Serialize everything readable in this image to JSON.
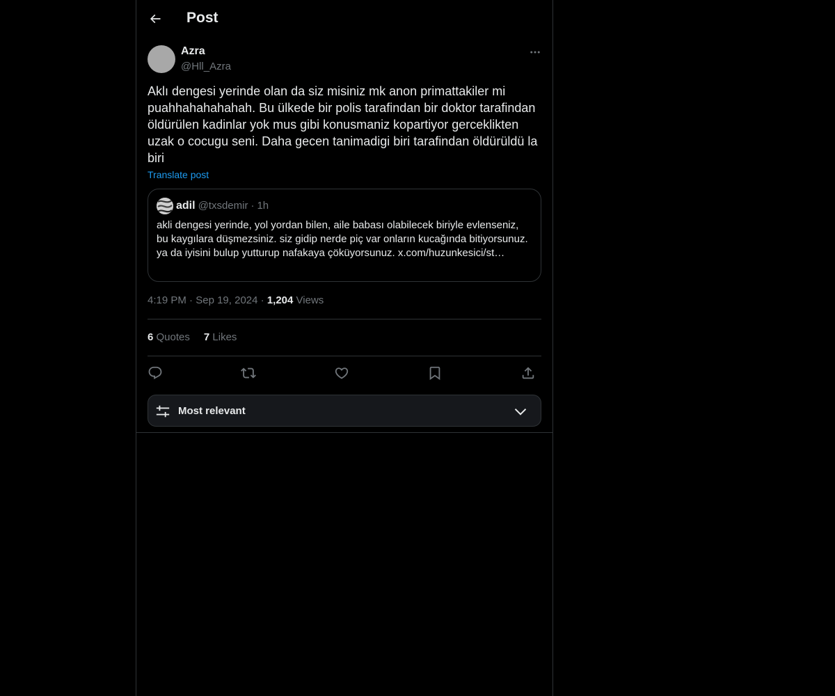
{
  "header": {
    "title": "Post"
  },
  "post": {
    "author": {
      "name": "Azra",
      "handle": "@Hll_Azra"
    },
    "text": "Aklı dengesi yerinde olan da siz misiniz mk anon primattakiler mi puahhahahahahah. Bu ülkede bir polis tarafindan bir doktor tarafindan öldürülen kadinlar yok mus gibi konusmaniz kopartiyor gerceklikten uzak o cocugu seni. Daha gecen tanimadigi biri tarafindan öldürüldü la biri",
    "translate_label": "Translate post",
    "quote": {
      "name": "adil",
      "handle": "@txsdemir",
      "separator": "·",
      "time": "1h",
      "text": "akli dengesi yerinde, yol yordan bilen, aile babası olabilecek biriyle evlenseniz, bu kaygılara düşmezsiniz. siz gidip nerde piç var onların kucağında bitiyorsunuz. ya da iyisini bulup yutturup nafakaya çöküyorsunuz. x.com/huzunkesici/st…"
    },
    "meta": {
      "time": "4:19 PM",
      "separator": "·",
      "date": "Sep 19, 2024",
      "views_count": "1,204",
      "views_label": "Views"
    },
    "stats": {
      "quotes_count": "6",
      "quotes_label": "Quotes",
      "likes_count": "7",
      "likes_label": "Likes"
    },
    "actions": {
      "icons": [
        "reply-icon",
        "repost-icon",
        "like-icon",
        "bookmark-icon",
        "share-icon"
      ]
    }
  },
  "sort": {
    "label": "Most relevant",
    "icon": "sliders-icon"
  },
  "colors": {
    "background": "#000000",
    "text": "#e7e9ea",
    "muted": "#71767b",
    "accent": "#1d9bf0",
    "border": "#2f3336",
    "sort_bg": "#16181c"
  }
}
